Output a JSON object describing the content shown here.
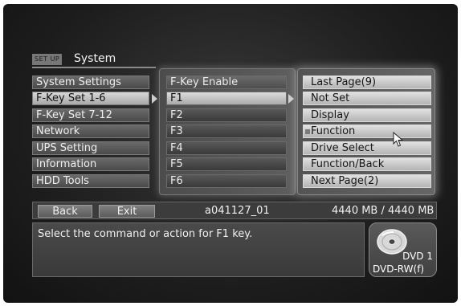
{
  "header": {
    "tag": "SET UP",
    "title": "System"
  },
  "menu": {
    "items": [
      {
        "label": "System Settings",
        "selected": false
      },
      {
        "label": "F-Key Set 1-6",
        "selected": true
      },
      {
        "label": "F-Key Set 7-12",
        "selected": false
      },
      {
        "label": "Network",
        "selected": false
      },
      {
        "label": "UPS Setting",
        "selected": false
      },
      {
        "label": "Information",
        "selected": false
      },
      {
        "label": "HDD Tools",
        "selected": false
      }
    ]
  },
  "fkeys": {
    "header": "F-Key Enable",
    "items": [
      {
        "label": "F1",
        "selected": true
      },
      {
        "label": "F2",
        "selected": false
      },
      {
        "label": "F3",
        "selected": false
      },
      {
        "label": "F4",
        "selected": false
      },
      {
        "label": "F5",
        "selected": false
      },
      {
        "label": "F6",
        "selected": false
      }
    ]
  },
  "options": {
    "items": [
      {
        "label": "Last Page(9)",
        "marked": false
      },
      {
        "label": "Not Set",
        "marked": false
      },
      {
        "label": "Display",
        "marked": false
      },
      {
        "label": "Function",
        "marked": true
      },
      {
        "label": "Drive Select",
        "marked": false
      },
      {
        "label": "Function/Back",
        "marked": false
      },
      {
        "label": "Next Page(2)",
        "marked": false
      }
    ]
  },
  "bottom_bar": {
    "back_label": "Back",
    "exit_label": "Exit",
    "title_name": "a041127_01",
    "capacity": "4440 MB / 4440 MB"
  },
  "message": "Select the command or action for F1 key.",
  "disc": {
    "number": "DVD 1",
    "type": "DVD-RW(f)",
    "icon": "dvd-disc-icon"
  }
}
